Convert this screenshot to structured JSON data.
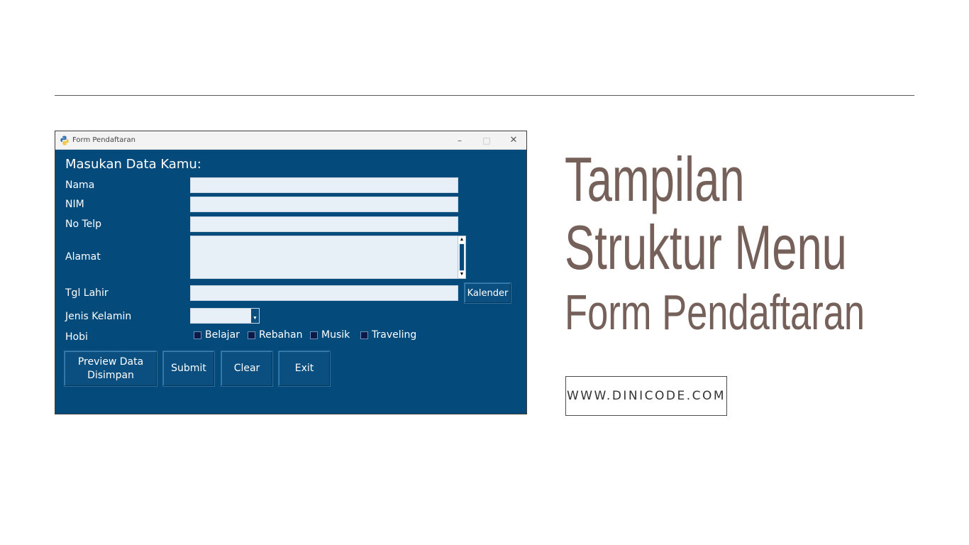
{
  "window": {
    "title": "Form Pendaftaran",
    "controls": {
      "minimize": "–",
      "maximize": "□",
      "close": "✕"
    },
    "heading": "Masukan Data Kamu:",
    "labels": {
      "nama": "Nama",
      "nim": "NIM",
      "no_telp": "No Telp",
      "alamat": "Alamat",
      "tgl_lahir": "Tgl Lahir",
      "jenis_kelamin": "Jenis Kelamin",
      "hobi": "Hobi"
    },
    "fields": {
      "nama": "",
      "nim": "",
      "no_telp": "",
      "alamat": "",
      "tgl_lahir": "",
      "jenis_kelamin": ""
    },
    "calendar_button": "Kalender",
    "hobbies": [
      {
        "label": "Belajar",
        "checked": false
      },
      {
        "label": "Rebahan",
        "checked": false
      },
      {
        "label": "Musik",
        "checked": false
      },
      {
        "label": "Traveling",
        "checked": false
      }
    ],
    "buttons": {
      "preview": "Preview Data\nDisimpan",
      "submit": "Submit",
      "clear": "Clear",
      "exit": "Exit"
    },
    "colors": {
      "form_bg": "#044a7b",
      "field_bg": "#e8f0f7"
    }
  },
  "headline": {
    "line1": "Tampilan",
    "line2": "Struktur Menu",
    "line3": "Form Pendaftaran",
    "color": "#76605a"
  },
  "site": "WWW.DINICODE.COM"
}
